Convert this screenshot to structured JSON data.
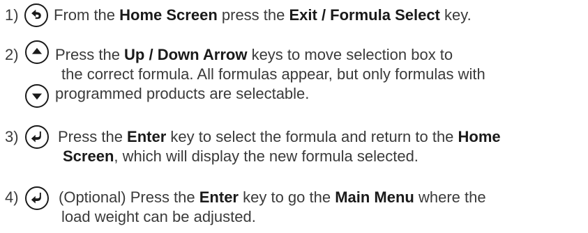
{
  "steps": [
    {
      "number": "1)",
      "icons": [
        "back-arrow-icon"
      ],
      "lines": [
        [
          {
            "text": "From the ",
            "bold": false
          },
          {
            "text": "Home Screen",
            "bold": true
          },
          {
            "text": " press the ",
            "bold": false
          },
          {
            "text": "Exit / Formula Select",
            "bold": true
          },
          {
            "text": " key.",
            "bold": false
          }
        ]
      ]
    },
    {
      "number": "2)",
      "icons": [
        "up-arrow-icon",
        "down-arrow-icon"
      ],
      "lines": [
        [
          {
            "text": "Press the ",
            "bold": false
          },
          {
            "text": "Up / Down Arrow",
            "bold": true
          },
          {
            "text": " keys to move selection box to",
            "bold": false
          }
        ],
        [
          {
            "text": "the correct formula. All formulas appear, but only formulas with",
            "bold": false
          }
        ],
        [
          {
            "text": "programmed products are selectable.",
            "bold": false
          }
        ]
      ]
    },
    {
      "number": "3)",
      "icons": [
        "enter-key-icon"
      ],
      "lines": [
        [
          {
            "text": "Press the ",
            "bold": false
          },
          {
            "text": "Enter",
            "bold": true
          },
          {
            "text": " key to select the formula and return to the ",
            "bold": false
          },
          {
            "text": "Home",
            "bold": true
          }
        ],
        [
          {
            "text": "Screen",
            "bold": true
          },
          {
            "text": ", which will display the new formula selected.",
            "bold": false
          }
        ]
      ]
    },
    {
      "number": "4)",
      "icons": [
        "enter-key-icon"
      ],
      "lines": [
        [
          {
            "text": "(Optional) Press the ",
            "bold": false
          },
          {
            "text": "Enter",
            "bold": true
          },
          {
            "text": " key to go the ",
            "bold": false
          },
          {
            "text": "Main Menu",
            "bold": true
          },
          {
            "text": " where the",
            "bold": false
          }
        ],
        [
          {
            "text": "load weight can be adjusted.",
            "bold": false
          }
        ]
      ]
    }
  ]
}
